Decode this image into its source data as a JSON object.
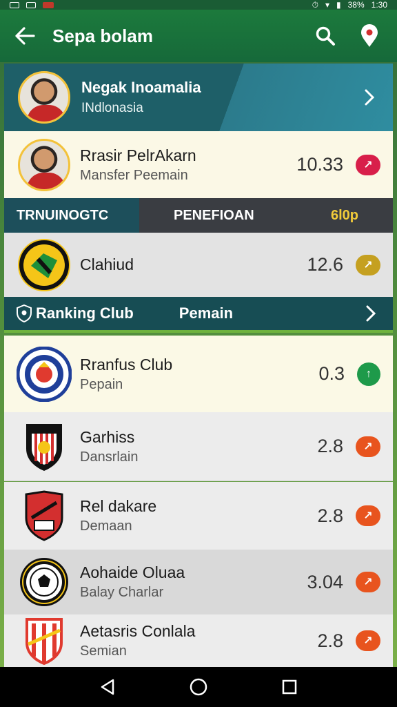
{
  "status_bar": {
    "battery_text": "38%",
    "time": "1:30"
  },
  "appbar": {
    "title": "Sepa bolam"
  },
  "header": {
    "name": "Negak Inoamalia",
    "subtitle": "INdlonasia"
  },
  "featured": {
    "name": "Rrasir PelrAkarn",
    "subtitle": "Mansfer Peemain",
    "score": "10.33"
  },
  "strip": {
    "tab_a": "TRNUINOGTC",
    "tab_b": "PENEFIOAN",
    "tab_b_value": "6l0p"
  },
  "club_row": {
    "name": "Clahiud",
    "score": "12.6"
  },
  "ranking": {
    "label": "Ranking Club",
    "label2": "Pemain"
  },
  "list": [
    {
      "name": "Rranfus Club",
      "subtitle": "Pepain",
      "score": "0.3",
      "badge_color": "#1e9a4a"
    },
    {
      "name": "Garhiss",
      "subtitle": "Dansrlain",
      "score": "2.8",
      "badge_color": "#e8541e"
    },
    {
      "name": "Rel dakare",
      "subtitle": "Demaan",
      "score": "2.8",
      "badge_color": "#e8541e"
    },
    {
      "name": "Aohaide Oluaa",
      "subtitle": "Balay Charlar",
      "score": "3.04",
      "badge_color": "#e8541e"
    },
    {
      "name": "Aetasris Conlala",
      "subtitle": "Semian",
      "score": "2.8",
      "badge_color": "#e8541e"
    }
  ],
  "colors": {
    "appbar": "#1c7a3c",
    "header": "#1e5f68",
    "red_badge": "#d81f4a",
    "gold_badge": "#c5a020"
  }
}
